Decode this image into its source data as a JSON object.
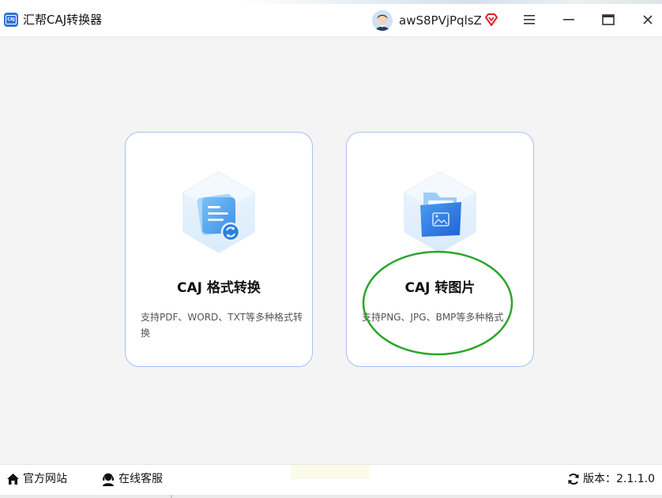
{
  "app": {
    "title": "汇帮CAJ转换器",
    "logo_text": "CAJ",
    "accent_color": "#2f73d8"
  },
  "user": {
    "name": "awS8PVjPqlsZ",
    "vip_color": "#e0202a"
  },
  "window_controls": [
    "menu-icon",
    "minimize-icon",
    "maximize-icon",
    "close-icon"
  ],
  "cards": [
    {
      "title": "CAJ 格式转换",
      "description": "支持PDF、WORD、TXT等多种格式转换",
      "icon": "document-convert-icon"
    },
    {
      "title": "CAJ 转图片",
      "description": "支持PNG、JPG、BMP等多种格式",
      "icon": "image-folder-icon"
    }
  ],
  "highlight_color": "#2aa52a",
  "footer": {
    "website_label": "官方网站",
    "support_label": "在线客服",
    "version_label": "版本：2.1.1.0"
  }
}
